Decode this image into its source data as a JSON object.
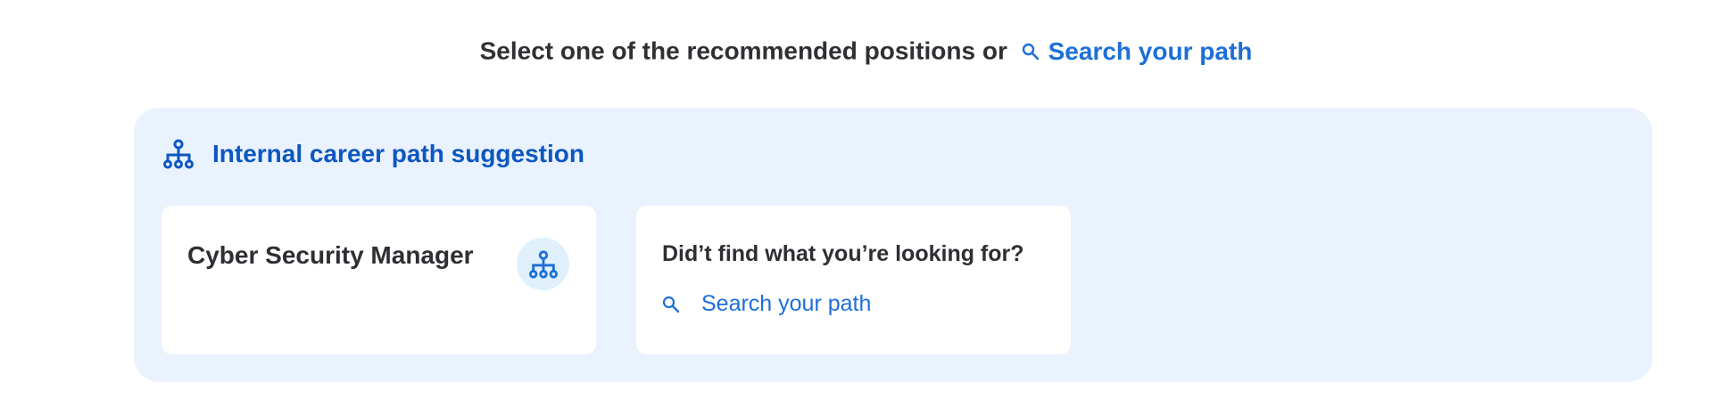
{
  "header": {
    "prompt_text": "Select one of the recommended positions or",
    "search_link_label": "Search your path",
    "search_icon": "search-icon"
  },
  "suggestions_panel": {
    "title": "Internal career path suggestion",
    "title_icon": "org-chart-icon",
    "accent_color": "#0c57c2",
    "background_color": "#eaf2fd"
  },
  "position_cards": [
    {
      "title": "Cyber Security Manager",
      "icon": "org-chart-icon"
    }
  ],
  "search_card": {
    "question": "Did’t find what you’re looking for?",
    "link_label": "Search your path",
    "icon": "search-icon"
  },
  "colors": {
    "link": "#1d6fd8",
    "text": "#2e2e33"
  }
}
